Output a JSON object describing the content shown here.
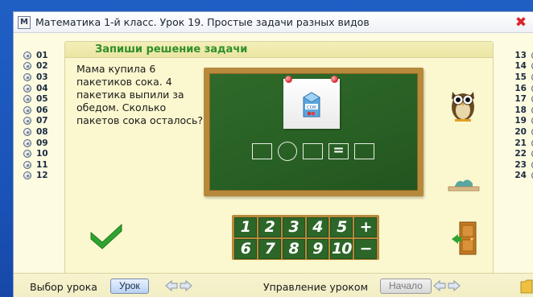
{
  "window": {
    "title": "Математика 1-й класс. Урок 19. Простые задачи разных видов",
    "app_icon_text": "M",
    "close_symbol": "✖"
  },
  "lessons_left": [
    "01",
    "02",
    "03",
    "04",
    "05",
    "06",
    "07",
    "08",
    "09",
    "10",
    "11",
    "12"
  ],
  "lessons_right": [
    "13",
    "14",
    "15",
    "16",
    "17",
    "18",
    "19",
    "20",
    "21",
    "22",
    "23",
    "24"
  ],
  "panel": {
    "heading": "Запиши решение задачи",
    "task_text": "Мама купила 6 пакетиков сока. 4 пакетика выпили за обедом. Сколько пакетов сока осталось?",
    "equation_sign": "=",
    "juice_label": "СОК"
  },
  "keypad": {
    "row1": [
      "1",
      "2",
      "3",
      "4",
      "5",
      "+"
    ],
    "row2": [
      "6",
      "7",
      "8",
      "9",
      "10",
      "−"
    ]
  },
  "bottom": {
    "lesson_select_label": "Выбор урока",
    "lesson_button": "Урок",
    "lesson_control_label": "Управление уроком",
    "start_button": "Начало"
  },
  "colors": {
    "board_green": "#2c6628",
    "heading_green": "#2f8f2a",
    "frame_wood": "#b68a3a",
    "background_blue": "#1f5fc4"
  }
}
